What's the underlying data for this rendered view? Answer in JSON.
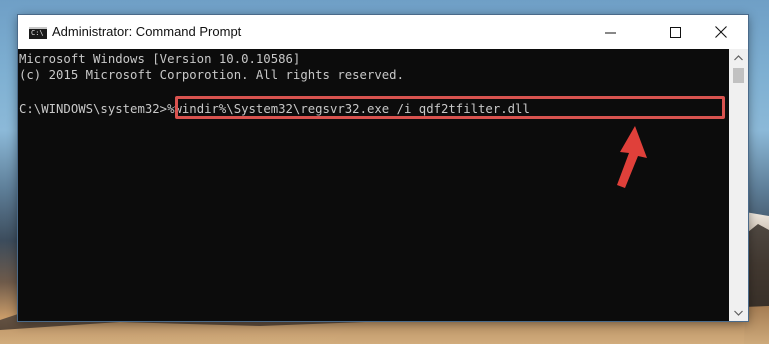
{
  "window": {
    "title": "Administrator: Command Prompt",
    "app_icon_text": "C:\\",
    "minimize_icon": "minimize-icon",
    "maximize_icon": "maximize-icon",
    "close_icon": "close-icon"
  },
  "console": {
    "line1": "Microsoft Windows [Version 10.0.10586]",
    "line2": "(c) 2015 Microsoft Corporotion. All rights reserved.",
    "prompt": "C:\\WINDOWS\\system32>",
    "command": "%windir%\\System32\\regsvr32.exe /i qdf2tfilter.dll"
  },
  "colors": {
    "console_bg": "#0c0c0c",
    "console_text": "#c8c8c8",
    "highlight": "#d9534f",
    "arrow": "#e0403a"
  },
  "annotations": {
    "arrow_icon": "red-arrow-icon"
  }
}
